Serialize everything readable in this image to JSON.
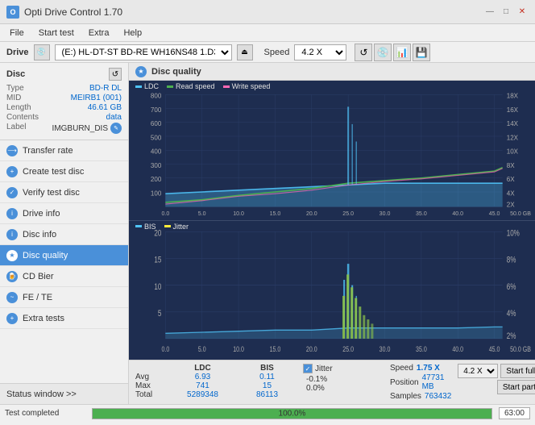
{
  "title_bar": {
    "icon": "O",
    "title": "Opti Drive Control 1.70",
    "minimize": "—",
    "maximize": "□",
    "close": "✕"
  },
  "menu": {
    "items": [
      "File",
      "Start test",
      "Extra",
      "Help"
    ]
  },
  "drive_bar": {
    "label": "Drive",
    "drive_value": "(E:) HL-DT-ST BD-RE  WH16NS48 1.D3",
    "speed_label": "Speed",
    "speed_value": "4.2 X"
  },
  "disc": {
    "title": "Disc",
    "type_label": "Type",
    "type_value": "BD-R DL",
    "mid_label": "MID",
    "mid_value": "MEIRB1 (001)",
    "length_label": "Length",
    "length_value": "46.61 GB",
    "contents_label": "Contents",
    "contents_value": "data",
    "label_label": "Label",
    "label_value": "IMGBURN_DIS"
  },
  "nav_items": [
    {
      "id": "transfer-rate",
      "label": "Transfer rate",
      "active": false
    },
    {
      "id": "create-test-disc",
      "label": "Create test disc",
      "active": false
    },
    {
      "id": "verify-test-disc",
      "label": "Verify test disc",
      "active": false
    },
    {
      "id": "drive-info",
      "label": "Drive info",
      "active": false
    },
    {
      "id": "disc-info",
      "label": "Disc info",
      "active": false
    },
    {
      "id": "disc-quality",
      "label": "Disc quality",
      "active": true
    },
    {
      "id": "cd-bier",
      "label": "CD Bier",
      "active": false
    },
    {
      "id": "fe-te",
      "label": "FE / TE",
      "active": false
    },
    {
      "id": "extra-tests",
      "label": "Extra tests",
      "active": false
    }
  ],
  "status_window": "Status window >>",
  "disc_quality": {
    "title": "Disc quality"
  },
  "legend_top": {
    "ldc": "LDC",
    "read": "Read speed",
    "write": "Write speed"
  },
  "legend_bottom": {
    "bis": "BIS",
    "jitter": "Jitter"
  },
  "stats": {
    "headers": [
      "LDC",
      "BIS"
    ],
    "avg_label": "Avg",
    "avg_ldc": "6.93",
    "avg_bis": "0.11",
    "avg_jitter": "-0.1%",
    "max_label": "Max",
    "max_ldc": "741",
    "max_bis": "15",
    "max_jitter": "0.0%",
    "total_label": "Total",
    "total_ldc": "5289348",
    "total_bis": "86113",
    "jitter_label": "Jitter",
    "speed_label": "Speed",
    "speed_value": "1.75 X",
    "speed_select": "4.2 X",
    "position_label": "Position",
    "position_value": "47731 MB",
    "samples_label": "Samples",
    "samples_value": "763432",
    "start_full": "Start full",
    "start_part": "Start part"
  },
  "status_bar": {
    "text": "Test completed",
    "progress": 100,
    "progress_label": "100.0%",
    "time": "63:00"
  },
  "chart_top": {
    "y_labels": [
      "800",
      "700",
      "600",
      "500",
      "400",
      "300",
      "200",
      "100"
    ],
    "x_labels": [
      "0.0",
      "5.0",
      "10.0",
      "15.0",
      "20.0",
      "25.0",
      "30.0",
      "35.0",
      "40.0",
      "45.0",
      "50.0 GB"
    ],
    "right_labels": [
      "18X",
      "16X",
      "14X",
      "12X",
      "10X",
      "8X",
      "6X",
      "4X",
      "2X"
    ]
  },
  "chart_bottom": {
    "y_labels": [
      "20",
      "15",
      "10",
      "5"
    ],
    "x_labels": [
      "0.0",
      "5.0",
      "10.0",
      "15.0",
      "20.0",
      "25.0",
      "30.0",
      "35.0",
      "40.0",
      "45.0",
      "50.0 GB"
    ],
    "right_labels": [
      "10%",
      "8%",
      "6%",
      "4%",
      "2%"
    ]
  }
}
